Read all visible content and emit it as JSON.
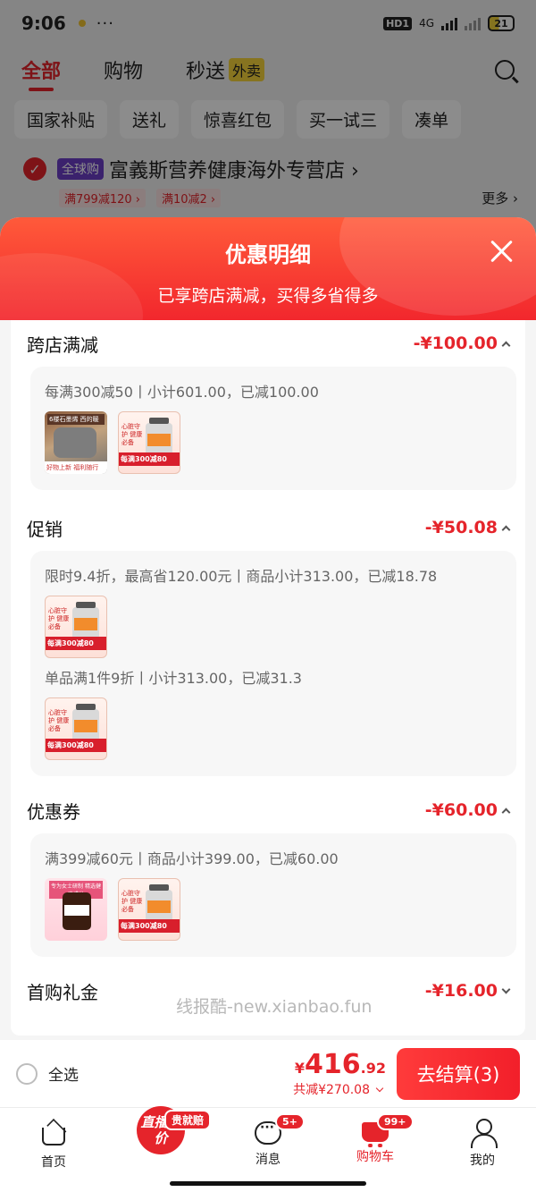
{
  "status_bar": {
    "time": "9:06",
    "more": "···",
    "hd": "HD1",
    "net": "4G",
    "battery": "21"
  },
  "top_tabs": [
    {
      "label": "全部",
      "active": true
    },
    {
      "label": "购物",
      "active": false
    },
    {
      "label": "秒送",
      "active": false,
      "tag": "外卖"
    }
  ],
  "chips": [
    "国家补贴",
    "送礼",
    "惊喜红包",
    "买一试三",
    "凑单"
  ],
  "store": {
    "badge": "全球购",
    "name": "富義斯营养健康海外专营店 ›",
    "promos": [
      "满799减120 ›",
      "满10减2 ›"
    ],
    "more": "更多 ›"
  },
  "sheet": {
    "title": "优惠明细",
    "subtitle": "已享跨店满减，买得多省得多",
    "sections": [
      {
        "title": "跨店满减",
        "amount": "-¥100.00",
        "cards": [
          {
            "desc": "每满300减50丨小计601.00，已减100.00",
            "thumbs": [
              "pillow",
              "bottle"
            ]
          }
        ]
      },
      {
        "title": "促销",
        "amount": "-¥50.08",
        "cards": [
          {
            "desc": "限时9.4折，最高省120.00元丨商品小计313.00，已减18.78",
            "thumbs": [
              "bottle"
            ]
          },
          {
            "desc": "单品满1件9折丨小计313.00，已减31.3",
            "thumbs": [
              "bottle"
            ]
          }
        ]
      },
      {
        "title": "优惠券",
        "amount": "-¥60.00",
        "cards": [
          {
            "desc": "满399减60元丨商品小计399.00，已减60.00",
            "thumbs": [
              "bm",
              "bottle"
            ]
          }
        ]
      },
      {
        "title": "首购礼金",
        "amount": "-¥16.00"
      }
    ],
    "thumb_text": {
      "pillow_cap": "6楼石墨烯 西的暖",
      "pillow_bar": "好物上新 福利随行",
      "bottle_text": "心脏守护 健康必备",
      "bottle_banner": "每满300减80",
      "bm_top": "专为女士研制 精选健康成分"
    },
    "watermark": "线报酷-new.xianbao.fun"
  },
  "pay_bar": {
    "select_all": "全选",
    "currency": "¥",
    "total_int": "416",
    "total_dec": ".92",
    "saving": "共减¥270.08",
    "checkout": "去结算(3)"
  },
  "tab_bar": [
    {
      "label": "首页",
      "icon": "home-icon"
    },
    {
      "label": "直播比价",
      "icon": "live-icon",
      "tag": "贵就赔"
    },
    {
      "label": "消息",
      "icon": "message-icon",
      "badge": "5+"
    },
    {
      "label": "购物车",
      "icon": "cart-icon",
      "badge": "99+"
    },
    {
      "label": "我的",
      "icon": "profile-icon"
    }
  ],
  "colors": {
    "accent": "#e5242b",
    "header_top": "#ff5a3a"
  }
}
